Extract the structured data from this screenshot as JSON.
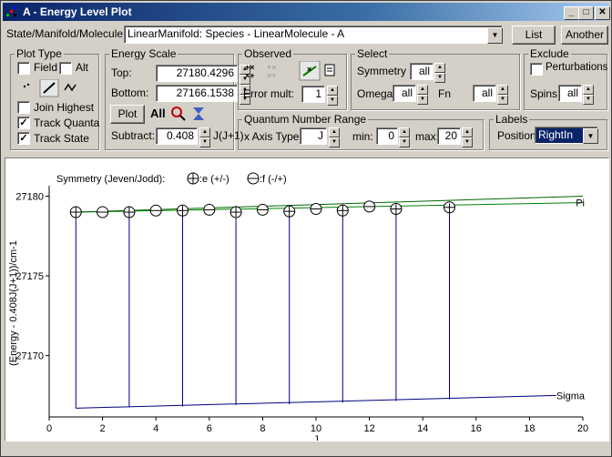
{
  "window": {
    "title": "A - Energy Level Plot",
    "min_icon": "minimize-icon",
    "max_icon": "maximize-icon",
    "close_icon": "close-icon"
  },
  "state": {
    "label": "State/Manifold/Molecule:",
    "value": "LinearManifold: Species - LinearMolecule - A",
    "list_button": "List",
    "another_button": "Another"
  },
  "plot_type": {
    "title": "Plot Type",
    "field": "Field",
    "field_checked": false,
    "alt": "Alt",
    "alt_checked": false,
    "join_highest": "Join Highest",
    "join_highest_checked": false,
    "track_quanta": "Track Quanta",
    "track_quanta_checked": true,
    "track_state": "Track State",
    "track_state_checked": true
  },
  "energy_scale": {
    "title": "Energy Scale",
    "top_label": "Top:",
    "top_value": "27180.4296",
    "bottom_label": "Bottom:",
    "bottom_value": "27166.1538",
    "plot_button": "Plot",
    "all_label": "All",
    "subtract_label": "Subtract:",
    "subtract_value": "0.408",
    "subtract_unit": "J(J+1)"
  },
  "observed": {
    "title": "Observed",
    "error_mult_label": "Error mult:",
    "error_mult_value": "1"
  },
  "select": {
    "title": "Select",
    "symmetry_label": "Symmetry",
    "symmetry_value": "all",
    "omega_label": "Omega",
    "omega_value": "all",
    "fn_label": "Fn",
    "fn_value": "all"
  },
  "exclude": {
    "title": "Exclude",
    "perturbations": "Perturbations",
    "perturbations_checked": false,
    "spins_label": "Spins:",
    "spins_value": "all"
  },
  "quantum_range": {
    "title": "Quantum Number Range",
    "x_axis_label": "x Axis Type",
    "x_axis_value": "J",
    "min_label": "min:",
    "min_value": "0",
    "max_label": "max:",
    "max_value": "20"
  },
  "labels": {
    "title": "Labels",
    "position_label": "Position",
    "position_value": "RightIn"
  },
  "chart_data": {
    "type": "line",
    "legend_text": "Symmetry (Jeven/Jodd):",
    "legend_e": ":e (+/-)",
    "legend_f": ":f (-/+)",
    "xlabel": "J",
    "ylabel": "(Energy - 0.408J(J+1))/cm-1",
    "xlim": [
      0,
      20
    ],
    "ylim": [
      27166.15,
      27180.43
    ],
    "x_ticks": [
      "0",
      "2",
      "4",
      "6",
      "8",
      "10",
      "12",
      "14",
      "16",
      "18",
      "20"
    ],
    "y_ticks": [
      "27170",
      "27175",
      "27180"
    ],
    "y_tick_values": [
      27170,
      27175,
      27180
    ],
    "colors": {
      "pi": "#008000",
      "pi2": "#006400",
      "sigma": "#000080",
      "drop": "#000080"
    },
    "series": [
      {
        "name": "Pi",
        "x": [
          1,
          20
        ],
        "y": [
          27179.0,
          27179.6
        ]
      },
      {
        "name": "Pi",
        "x": [
          1,
          20
        ],
        "y": [
          27179.0,
          27180.0
        ]
      },
      {
        "name": "Sigma",
        "x": [
          1,
          19
        ],
        "y": [
          27166.7,
          27167.5
        ]
      }
    ],
    "f_points": {
      "x": [
        1,
        2,
        3,
        4,
        5,
        6,
        7,
        8,
        9,
        10,
        11,
        12,
        13,
        15
      ],
      "y": [
        27179.0,
        27179.0,
        27179.0,
        27179.1,
        27179.1,
        27179.15,
        27179.0,
        27179.15,
        27179.05,
        27179.2,
        27179.1,
        27179.35,
        27179.2,
        27179.3
      ]
    },
    "e_points": {
      "x": [
        1,
        3,
        5,
        7,
        9,
        11,
        13,
        15
      ],
      "y": [
        27179.0,
        27179.0,
        27179.05,
        27179.05,
        27179.05,
        27179.1,
        27179.15,
        27179.2
      ]
    },
    "drop_lines": {
      "x": [
        1,
        3,
        5,
        7,
        9,
        11,
        13,
        15
      ],
      "y_top": [
        27179.0,
        27179.0,
        27179.05,
        27179.05,
        27179.05,
        27179.1,
        27179.15,
        27179.2
      ],
      "y_bottom": [
        27166.7,
        27166.75,
        27166.8,
        27166.9,
        27166.95,
        27167.05,
        27167.15,
        27167.25
      ]
    },
    "line_labels": [
      "Pi",
      "Sigma"
    ]
  }
}
